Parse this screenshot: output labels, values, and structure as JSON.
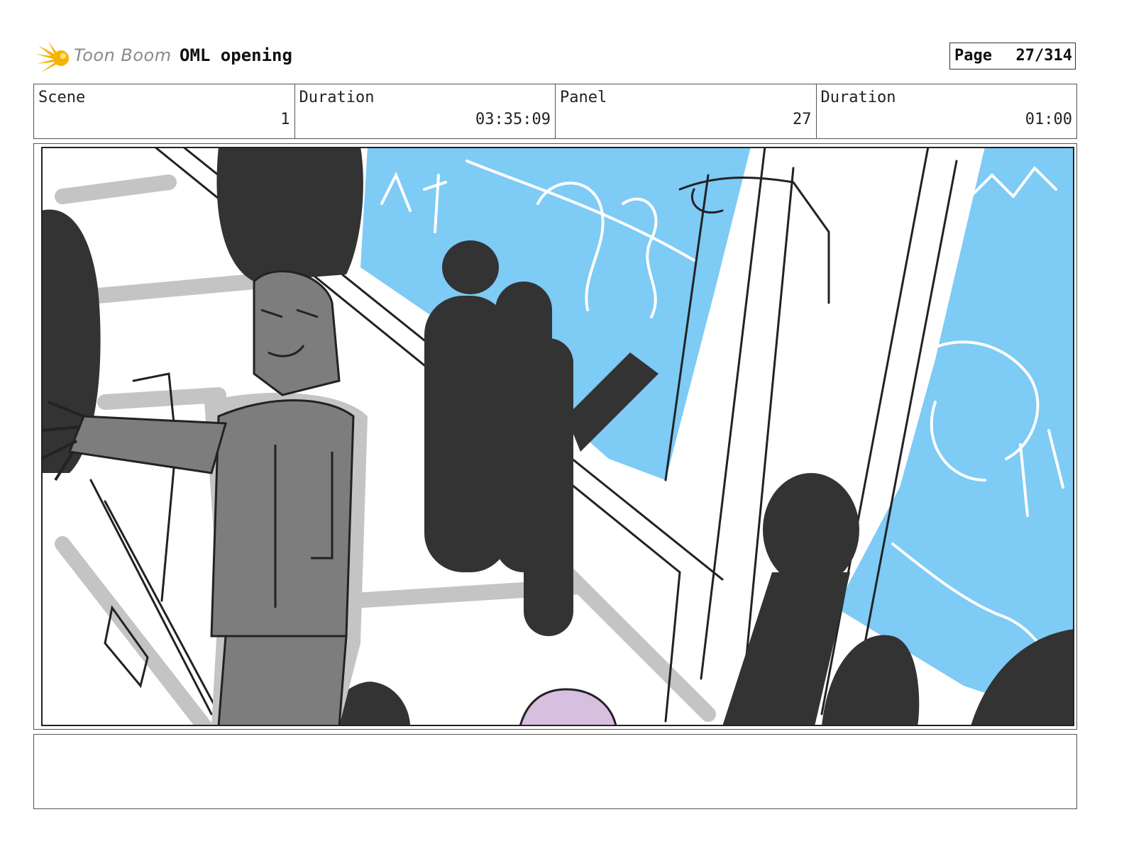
{
  "header": {
    "logo_text": "Toon Boom",
    "project_title": "OML opening",
    "page_label": "Page",
    "page_value": "27/314"
  },
  "info": {
    "scene_label": "Scene",
    "scene_value": "1",
    "scene_duration_label": "Duration",
    "scene_duration_value": "03:35:09",
    "panel_label": "Panel",
    "panel_value": "27",
    "panel_duration_label": "Duration",
    "panel_duration_value": "01:00"
  },
  "colors": {
    "screen_blue": "#7ecbf5",
    "silhouette": "#333333",
    "figure_gray": "#7d7d7d",
    "shadow_gray": "#c4c4c4",
    "purple_head": "#d7bfe0",
    "logo_orange": "#f5b400"
  },
  "notes": ""
}
